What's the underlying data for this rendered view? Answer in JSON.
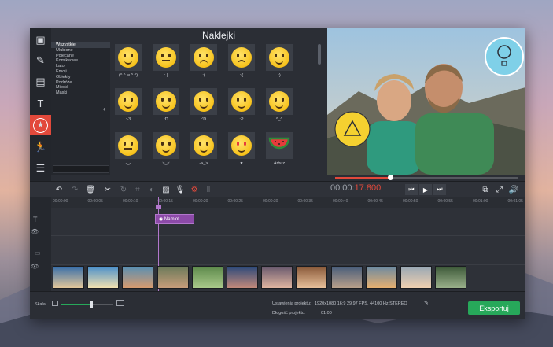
{
  "stickers_title": "Naklejki",
  "categories": [
    "Wszystkie",
    "Ulubione",
    "Polecane",
    "Komiksowe",
    "Lato",
    "Emoji",
    "Obiekty",
    "Podróże",
    "Miłość",
    "Maski"
  ],
  "stickers": [
    {
      "caption": "(^ ^ w ^ ^)",
      "mood": "happy"
    },
    {
      "caption": ": |",
      "mood": "neutral"
    },
    {
      "caption": ":(",
      "mood": "sad"
    },
    {
      "caption": ":'(",
      "mood": "cry"
    },
    {
      "caption": ":)",
      "mood": "smile"
    },
    {
      "caption": ":-3",
      "mood": "smile"
    },
    {
      "caption": ":D",
      "mood": "grin"
    },
    {
      "caption": ":'D",
      "mood": "laugh"
    },
    {
      "caption": ":P",
      "mood": "tongue"
    },
    {
      "caption": "^_^",
      "mood": "smile"
    },
    {
      "caption": "-_-",
      "mood": "neutral"
    },
    {
      "caption": ">_<",
      "mood": "squint"
    },
    {
      "caption": "->_>",
      "mood": "smirk"
    },
    {
      "caption": "♥",
      "mood": "love"
    },
    {
      "caption": "Arbuz",
      "mood": "watermelon"
    }
  ],
  "timer": {
    "prefix": "00:00:",
    "value": "17.800"
  },
  "ruler_ticks": [
    "00:00:00",
    "00:00:05",
    "00:00:10",
    "00:00:15",
    "00:00:20",
    "00:00:25",
    "00:00:30",
    "00:00:35",
    "00:00:40",
    "00:00:45",
    "00:00:50",
    "00:00:55",
    "00:01:00",
    "00:01:05"
  ],
  "title_clip": "Namiot",
  "bottom": {
    "scale_label": "Skala:",
    "settings_label": "Ustawienia projektu:",
    "settings_value": "1920x1080 16:9 29.97 FPS, 44100 Hz STEREO",
    "duration_label": "Długość projektu:",
    "duration_value": "01:00",
    "export_label": "Eksportuj",
    "scale_fraction": 0.58
  },
  "playback_progress": 0.3,
  "colors": {
    "accent": "#e2493b",
    "export": "#27a85a",
    "title_clip": "#8c4aa8"
  }
}
